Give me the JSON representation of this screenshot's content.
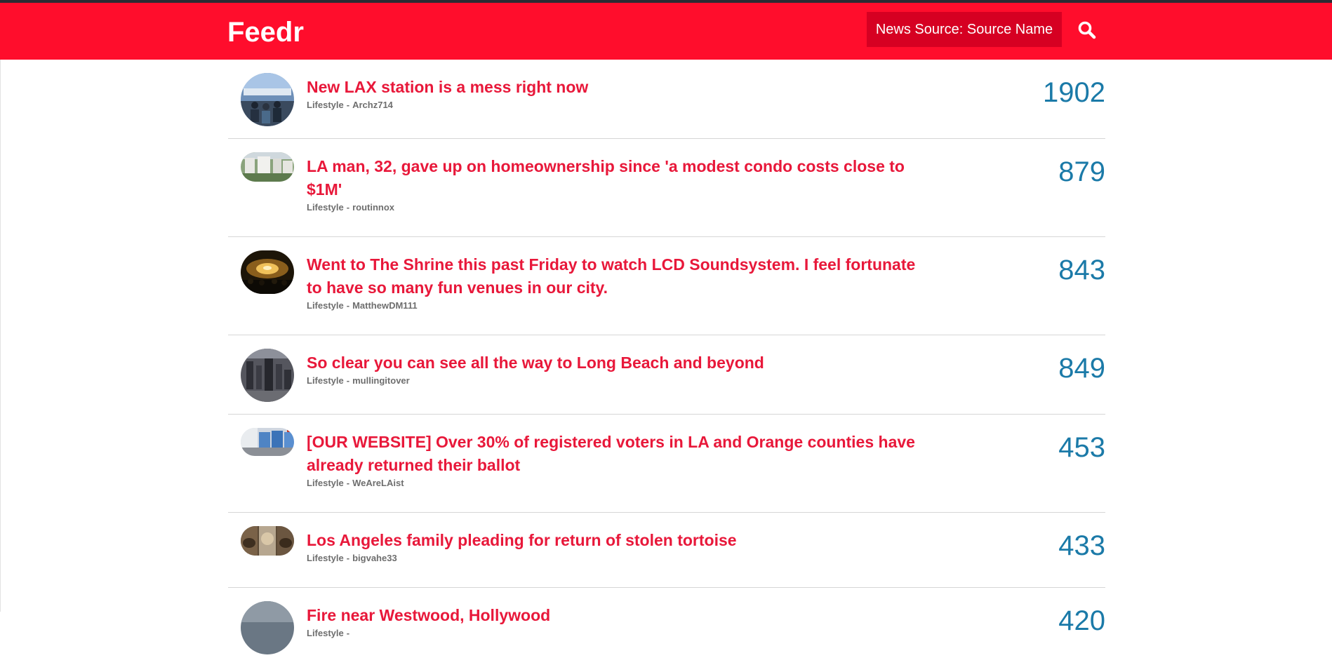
{
  "app": {
    "title": "Feedr",
    "source_label": "News Source: Source Name",
    "search_icon": "search-icon"
  },
  "colors": {
    "header_bg": "#ff0d2c",
    "title_color": "#e8183a",
    "score_color": "#1b7aa8"
  },
  "feed": {
    "items": [
      {
        "title": "New LAX station is a mess right now",
        "category": "Lifestyle",
        "separator": "-",
        "author": "Archz714",
        "score": "1902"
      },
      {
        "title": "LA man, 32, gave up on homeownership since 'a modest condo costs close to $1M'",
        "category": "Lifestyle",
        "separator": "-",
        "author": "routinnox",
        "score": "879"
      },
      {
        "title": "Went to The Shrine this past Friday to watch LCD Soundsystem. I feel fortunate to have so many fun venues in our city.",
        "category": "Lifestyle",
        "separator": "-",
        "author": "MatthewDM111",
        "score": "843"
      },
      {
        "title": "So clear you can see all the way to Long Beach and beyond",
        "category": "Lifestyle",
        "separator": "-",
        "author": "mullingitover",
        "score": "849"
      },
      {
        "title": "[OUR WEBSITE] Over 30% of registered voters in LA and Orange counties have already returned their ballot",
        "category": "Lifestyle",
        "separator": "-",
        "author": "WeAreLAist",
        "score": "453"
      },
      {
        "title": "Los Angeles family pleading for return of stolen tortoise",
        "category": "Lifestyle",
        "separator": "-",
        "author": "bigvahe33",
        "score": "433"
      },
      {
        "title": "Fire near Westwood, Hollywood",
        "category": "Lifestyle",
        "separator": "-",
        "author": "",
        "score": "420"
      }
    ]
  }
}
